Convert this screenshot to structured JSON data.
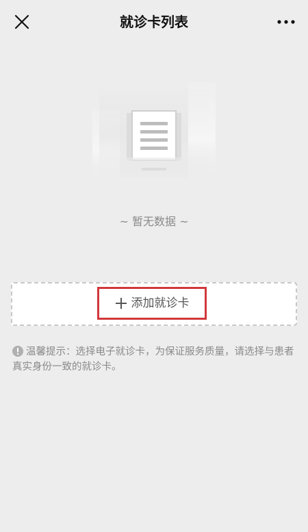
{
  "nav": {
    "title": "就诊卡列表",
    "close_icon": "close-icon",
    "more_icon": "more-dots-icon"
  },
  "empty_state": {
    "illustration": "document-placeholder-icon",
    "text": "~ 暂无数据 ~"
  },
  "add_card": {
    "icon": "plus-icon",
    "label": "添加就诊卡",
    "highlight_color": "#d2373a"
  },
  "tip": {
    "icon": "info-icon",
    "text": "温馨提示：选择电子就诊卡，为保证服务质量，请选择与患者真实身份一致的就诊卡。"
  }
}
